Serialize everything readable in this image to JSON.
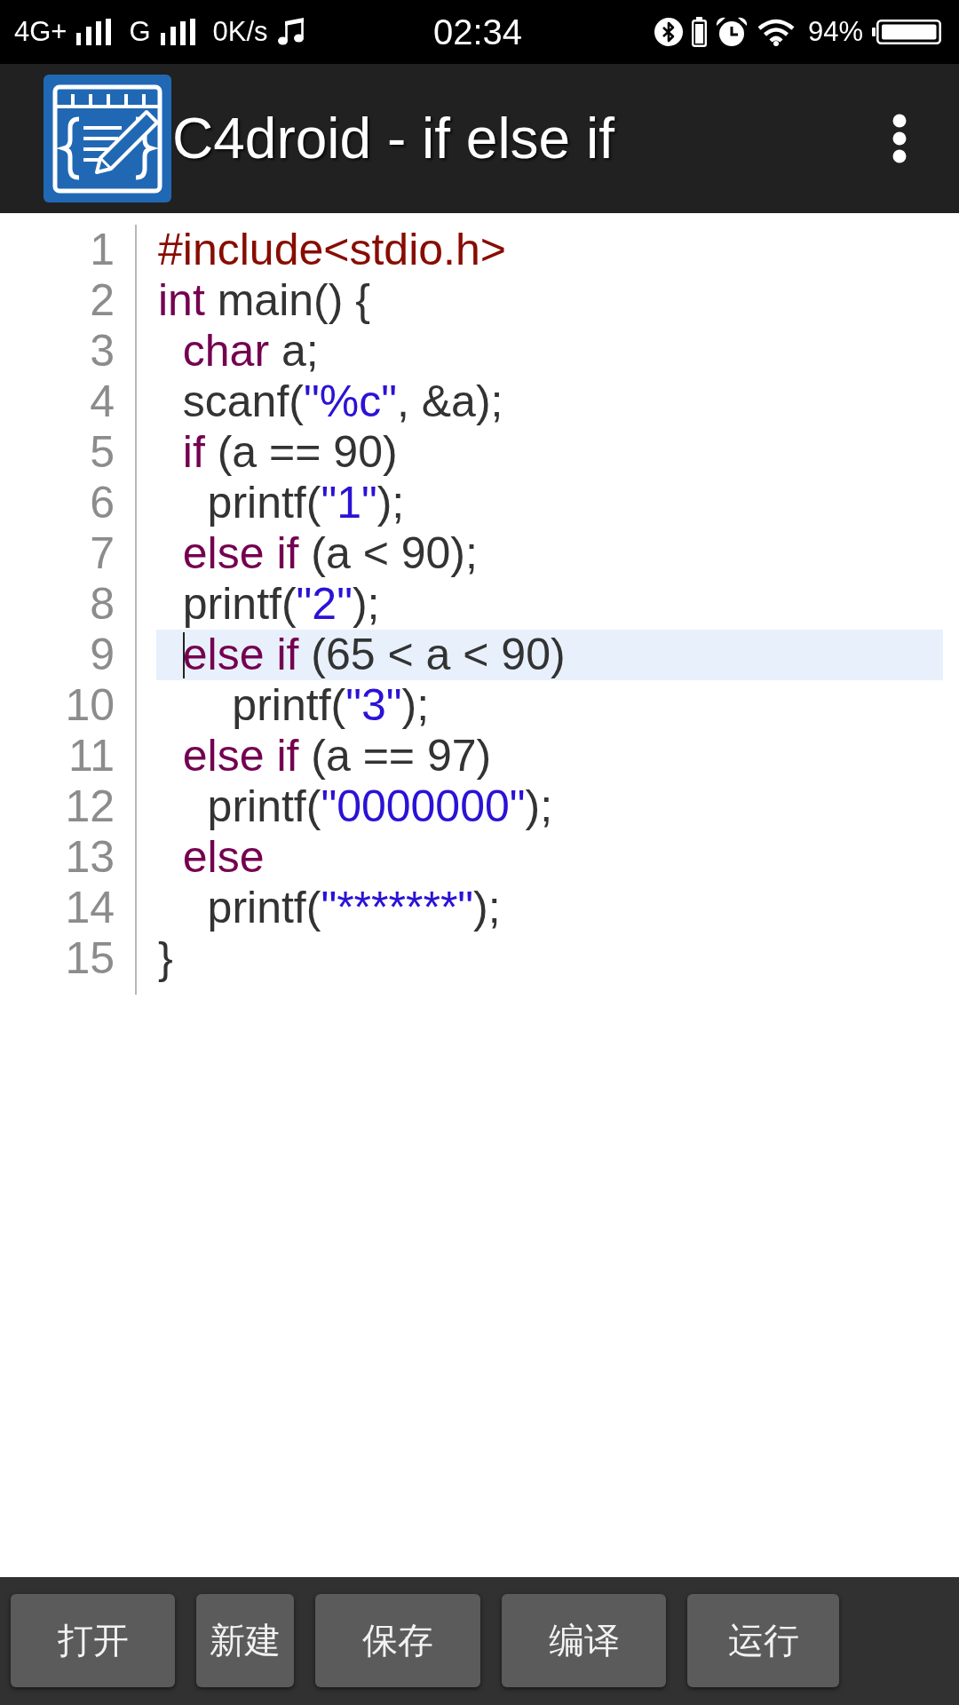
{
  "status_bar": {
    "network_1": "4G+",
    "network_2": "G",
    "data_speed": "0K/s",
    "time": "02:34",
    "battery_percent": "94%"
  },
  "app_bar": {
    "title": "C4droid - if else if"
  },
  "editor": {
    "lines": [
      {
        "number": "1",
        "current": false,
        "tokens": [
          {
            "kind": "preprocessor",
            "text": "#include<stdio.h>"
          }
        ]
      },
      {
        "number": "2",
        "current": false,
        "tokens": [
          {
            "kind": "keyword",
            "text": "int"
          },
          {
            "kind": "plain",
            "text": " main() {"
          }
        ]
      },
      {
        "number": "3",
        "current": false,
        "tokens": [
          {
            "kind": "keyword",
            "text": "  char"
          },
          {
            "kind": "plain",
            "text": " a;"
          }
        ]
      },
      {
        "number": "4",
        "current": false,
        "tokens": [
          {
            "kind": "plain",
            "text": "  scanf("
          },
          {
            "kind": "string",
            "text": "\"%c\""
          },
          {
            "kind": "plain",
            "text": ", &a);"
          }
        ]
      },
      {
        "number": "5",
        "current": false,
        "tokens": [
          {
            "kind": "keyword",
            "text": "  if"
          },
          {
            "kind": "plain",
            "text": " (a == 90)"
          }
        ]
      },
      {
        "number": "6",
        "current": false,
        "tokens": [
          {
            "kind": "plain",
            "text": "    printf("
          },
          {
            "kind": "string",
            "text": "\"1\""
          },
          {
            "kind": "plain",
            "text": ");"
          }
        ]
      },
      {
        "number": "7",
        "current": false,
        "tokens": [
          {
            "kind": "keyword",
            "text": "  else if"
          },
          {
            "kind": "plain",
            "text": " (a < 90);"
          }
        ]
      },
      {
        "number": "8",
        "current": false,
        "tokens": [
          {
            "kind": "plain",
            "text": "  printf("
          },
          {
            "kind": "string",
            "text": "\"2\""
          },
          {
            "kind": "plain",
            "text": ");"
          }
        ]
      },
      {
        "number": "9",
        "current": true,
        "tokens": [
          {
            "kind": "keyword",
            "text": "  else if"
          },
          {
            "kind": "plain",
            "text": " (65 < a < 90)"
          }
        ]
      },
      {
        "number": "10",
        "current": false,
        "tokens": [
          {
            "kind": "plain",
            "text": "      printf("
          },
          {
            "kind": "string",
            "text": "\"3\""
          },
          {
            "kind": "plain",
            "text": ");"
          }
        ]
      },
      {
        "number": "11",
        "current": false,
        "tokens": [
          {
            "kind": "keyword",
            "text": "  else if"
          },
          {
            "kind": "plain",
            "text": " (a == 97)"
          }
        ]
      },
      {
        "number": "12",
        "current": false,
        "tokens": [
          {
            "kind": "plain",
            "text": "    printf("
          },
          {
            "kind": "string",
            "text": "\"0000000\""
          },
          {
            "kind": "plain",
            "text": ");"
          }
        ]
      },
      {
        "number": "13",
        "current": false,
        "tokens": [
          {
            "kind": "keyword",
            "text": "  else"
          }
        ]
      },
      {
        "number": "14",
        "current": false,
        "tokens": [
          {
            "kind": "plain",
            "text": "    printf("
          },
          {
            "kind": "string",
            "text": "\"*******\""
          },
          {
            "kind": "plain",
            "text": ");"
          }
        ]
      },
      {
        "number": "15",
        "current": false,
        "tokens": [
          {
            "kind": "plain",
            "text": "}"
          }
        ]
      }
    ]
  },
  "toolbar": {
    "buttons": [
      "打开",
      "新建",
      "保存",
      "编译",
      "运行"
    ]
  }
}
